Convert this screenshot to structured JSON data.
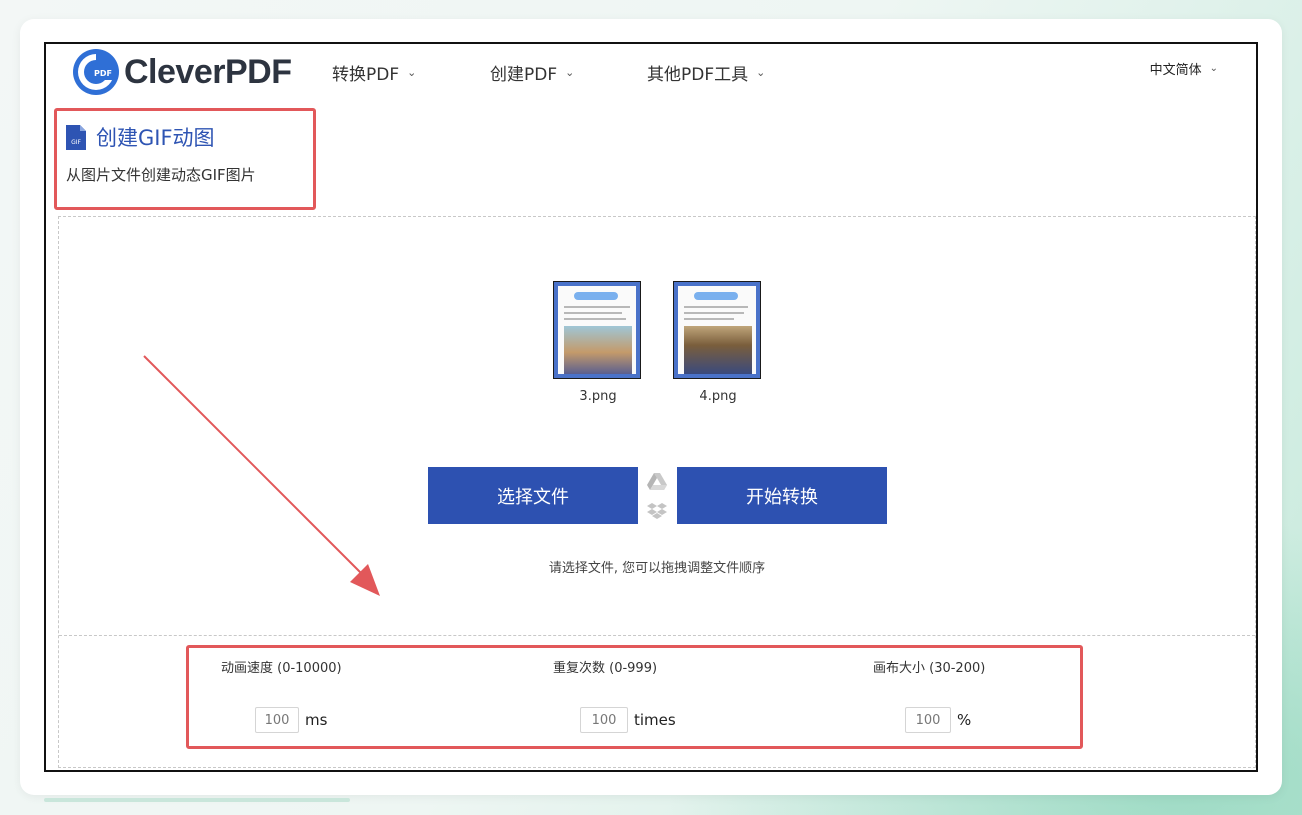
{
  "brand": {
    "name": "CleverPDF",
    "logo_badge": "PDF"
  },
  "nav": {
    "items": [
      {
        "label": "转换PDF"
      },
      {
        "label": "创建PDF"
      },
      {
        "label": "其他PDF工具"
      }
    ],
    "language": "中文简体"
  },
  "tool": {
    "icon_badge": "GIF",
    "title": "创建GIF动图",
    "subtitle": "从图片文件创建动态GIF图片"
  },
  "files": [
    {
      "name": "3.png"
    },
    {
      "name": "4.png"
    }
  ],
  "actions": {
    "select_label": "选择文件",
    "convert_label": "开始转换",
    "hint": "请选择文件, 您可以拖拽调整文件顺序"
  },
  "settings": [
    {
      "label": "动画速度 (0-10000)",
      "value": "100",
      "unit": "ms"
    },
    {
      "label": "重复次数 (0-999)",
      "value": "100",
      "unit": "times"
    },
    {
      "label": "画布大小 (30-200)",
      "value": "100",
      "unit": "%"
    }
  ],
  "colors": {
    "primary": "#2d51b1",
    "title": "#2e54b3",
    "annotation": "#e2585a"
  }
}
